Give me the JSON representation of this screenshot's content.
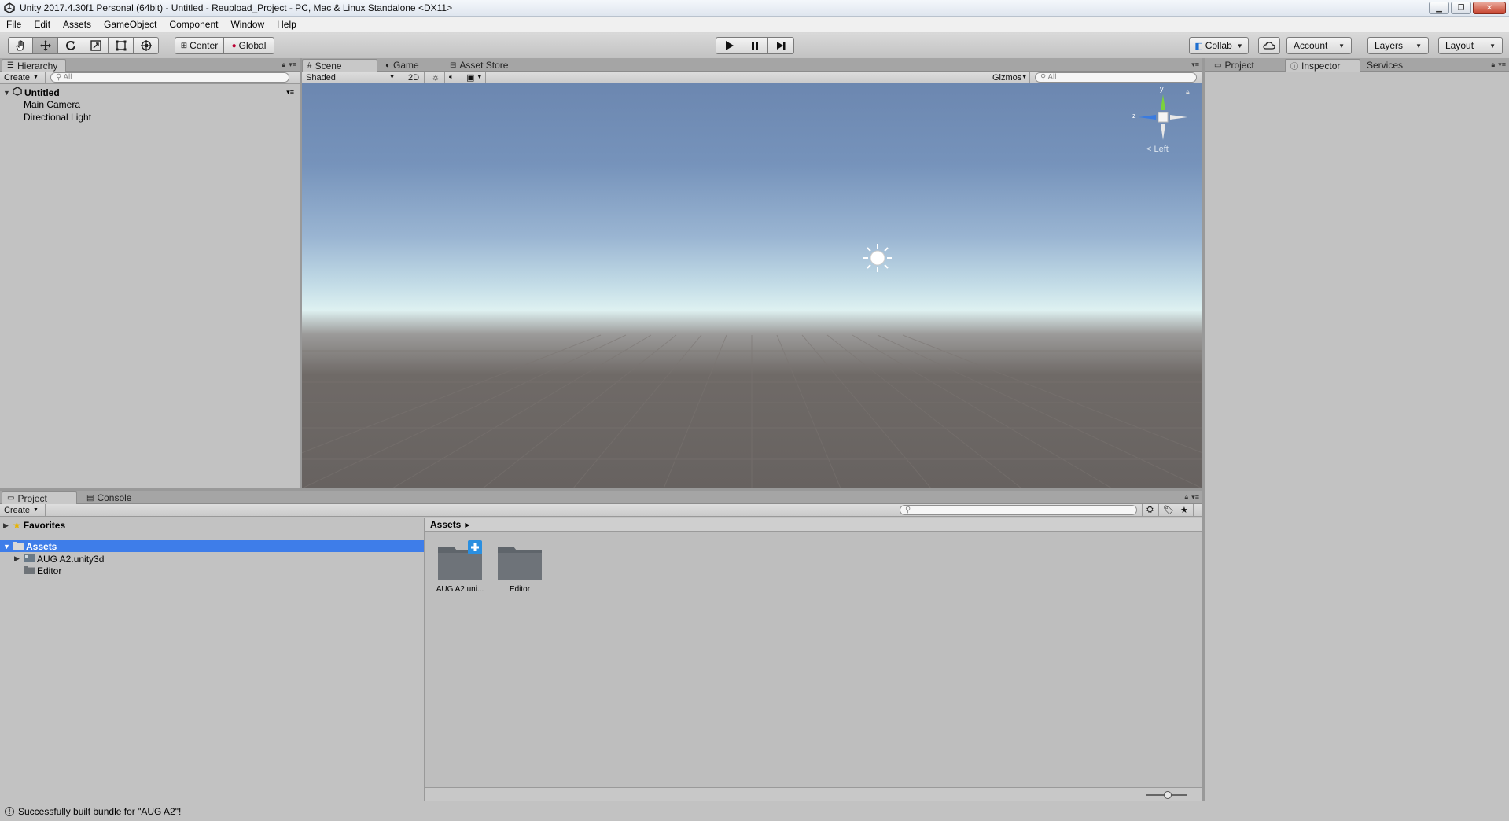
{
  "window": {
    "title": "Unity 2017.4.30f1 Personal (64bit) - Untitled - Reupload_Project - PC, Mac & Linux Standalone <DX11>",
    "controls": [
      "minimize-icon",
      "restore-icon",
      "close-icon"
    ]
  },
  "menubar": {
    "items": [
      "File",
      "Edit",
      "Assets",
      "GameObject",
      "Component",
      "Window",
      "Help"
    ]
  },
  "toolbar": {
    "tools": [
      "hand-icon",
      "move-icon",
      "rotate-icon",
      "scale-icon",
      "rect-icon",
      "transform-icon"
    ],
    "pivot_label": "Center",
    "space_label": "Global",
    "play": [
      "play-icon",
      "pause-icon",
      "step-icon"
    ],
    "collab_label": "Collab",
    "account_label": "Account",
    "layers_label": "Layers",
    "layout_label": "Layout"
  },
  "hierarchy": {
    "tab_label": "Hierarchy",
    "create_label": "Create",
    "search_placeholder": "All",
    "scene_name": "Untitled",
    "items": [
      "Main Camera",
      "Directional Light"
    ]
  },
  "scene": {
    "tabs": [
      "Scene",
      "Game",
      "Asset Store"
    ],
    "shading_label": "Shaded",
    "mode_2d_label": "2D",
    "gizmos_label": "Gizmos",
    "search_placeholder": "All",
    "gizmo_view_label": "< Left",
    "axis_y": "y",
    "axis_z": "z"
  },
  "right_panel": {
    "tabs": [
      "Project",
      "Inspector",
      "Services"
    ]
  },
  "project": {
    "tabs": [
      "Project",
      "Console"
    ],
    "create_label": "Create",
    "favorites_label": "Favorites",
    "assets_label": "Assets",
    "tree_items": [
      "AUG A2.unity3d",
      "Editor"
    ],
    "breadcrumb": "Assets",
    "grid_items": [
      "AUG A2.uni...",
      "Editor"
    ]
  },
  "status": {
    "message": "Successfully built bundle for \"AUG A2\"!"
  }
}
